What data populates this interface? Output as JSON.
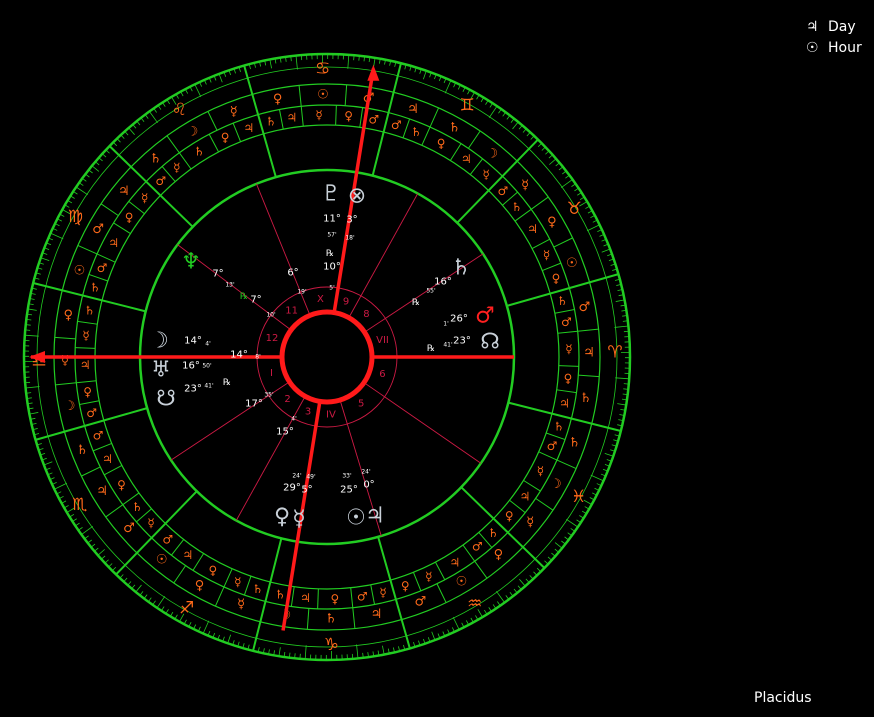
{
  "legend": {
    "day": {
      "symbol": "♃",
      "label": "Day"
    },
    "hour": {
      "symbol": "☉",
      "label": "Hour"
    }
  },
  "house_system": "Placidus",
  "colors": {
    "ring": "#22cc22",
    "axis": "#ff1a1a",
    "cusp_line": "#cc1a44",
    "planet_light": "#c8d0d8",
    "orange": "#ff6a1a",
    "text": "#ffffff"
  },
  "zodiac_signs": [
    {
      "symbol": "♈",
      "color": "#ff6a1a"
    },
    {
      "symbol": "♉",
      "color": "#ff6a1a"
    },
    {
      "symbol": "♊",
      "color": "#ff6a1a"
    },
    {
      "symbol": "♋",
      "color": "#ff6a1a"
    },
    {
      "symbol": "♌",
      "color": "#ff6a1a"
    },
    {
      "symbol": "♍",
      "color": "#ff6a1a"
    },
    {
      "symbol": "♎",
      "color": "#ff6a1a"
    },
    {
      "symbol": "♏",
      "color": "#ff6a1a"
    },
    {
      "symbol": "♐",
      "color": "#ff6a1a"
    },
    {
      "symbol": "♑",
      "color": "#ff6a1a"
    },
    {
      "symbol": "♒",
      "color": "#ff6a1a"
    },
    {
      "symbol": "♓",
      "color": "#ff6a1a"
    }
  ],
  "decan_rulers": [
    "♄",
    "♃",
    "♂",
    "☉",
    "♀",
    "☿",
    "☽",
    "♄",
    "♃",
    "♂",
    "☉",
    "♀",
    "☿",
    "☽",
    "♄",
    "♃",
    "♂",
    "☉",
    "♀",
    "☿",
    "☽",
    "♄",
    "♃",
    "♂",
    "☉",
    "♀",
    "☿",
    "☽",
    "♄",
    "♃",
    "♂",
    "☉",
    "♀",
    "☿",
    "☽",
    "♄"
  ],
  "term_rulers": [
    "♃",
    "♀",
    "☿",
    "♂",
    "♄",
    "♀",
    "☿",
    "♃",
    "♄",
    "♂",
    "☿",
    "♃",
    "♀",
    "♄",
    "♂",
    "♂",
    "♀",
    "☿",
    "♃",
    "♄",
    "♃",
    "♀",
    "♄",
    "☿",
    "♂",
    "☿",
    "♀",
    "♃",
    "♂",
    "♄",
    "♄",
    "☿",
    "♃",
    "♀",
    "♂",
    "♂",
    "♃",
    "♀",
    "♄",
    "☿",
    "♂",
    "♃",
    "♀",
    "☿",
    "♄",
    "♄",
    "♃",
    "♀",
    "♂",
    "☿",
    "♀",
    "☿",
    "♃",
    "♂",
    "♄",
    "♀",
    "♃",
    "☿",
    "♂",
    "♄"
  ],
  "houses": {
    "numbers": [
      "I",
      "2",
      "3",
      "IV",
      "5",
      "6",
      "VII",
      "8",
      "9",
      "X",
      "11",
      "12"
    ],
    "cusps": [
      {
        "deg": "14°",
        "min": "8'"
      },
      {
        "deg": "17°",
        "min": "35'"
      },
      {
        "deg": "15°",
        "min": "4'"
      },
      {
        "deg": "",
        "min": ""
      },
      {
        "deg": "",
        "min": ""
      },
      {
        "deg": "",
        "min": ""
      },
      {
        "deg": "",
        "min": ""
      },
      {
        "deg": "",
        "min": ""
      },
      {
        "deg": "",
        "min": ""
      },
      {
        "deg": "",
        "min": ""
      },
      {
        "deg": "6°",
        "min": "19'"
      },
      {
        "deg": "7°",
        "min": "10'"
      }
    ]
  },
  "planets": [
    {
      "name": "pluto",
      "symbol": "♇",
      "deg": "11°",
      "min": "57'",
      "retro": "℞",
      "color": "#c8d0d8"
    },
    {
      "name": "part-of-fortune",
      "symbol": "⊗",
      "deg": "3°",
      "min": "18'",
      "retro": "",
      "color": "#c8d0d8"
    },
    {
      "name": "mc",
      "symbol": "",
      "deg": "10°",
      "min": "5'",
      "retro": "",
      "color": "#ffffff"
    },
    {
      "name": "saturn",
      "symbol": "♄",
      "deg": "16°",
      "min": "55'",
      "retro": "℞",
      "color": "#c8d0d8"
    },
    {
      "name": "mars",
      "symbol": "♂",
      "deg": "26°",
      "min": "1'",
      "retro": "",
      "color": "#ff2020"
    },
    {
      "name": "north-node",
      "symbol": "☊",
      "deg": "23°",
      "min": "41'",
      "retro": "℞",
      "color": "#c8d0d8"
    },
    {
      "name": "neptune",
      "symbol": "♆",
      "deg": "7°",
      "min": "13'",
      "retro": "℞",
      "color": "#22cc22"
    },
    {
      "name": "moon",
      "symbol": "☽",
      "deg": "14°",
      "min": "4'",
      "retro": "",
      "color": "#c8d0d8"
    },
    {
      "name": "uranus",
      "symbol": "♅",
      "deg": "16°",
      "min": "50'",
      "retro": "",
      "color": "#c8d0d8"
    },
    {
      "name": "south-node",
      "symbol": "☋",
      "deg": "23°",
      "min": "41'",
      "retro": "℞",
      "color": "#c8d0d8"
    },
    {
      "name": "venus",
      "symbol": "♀",
      "deg": "29°",
      "min": "24'",
      "retro": "",
      "color": "#c8d0d8"
    },
    {
      "name": "mercury",
      "symbol": "☿",
      "deg": "5°",
      "min": "49'",
      "retro": "",
      "color": "#c8d0d8"
    },
    {
      "name": "sun",
      "symbol": "☉",
      "deg": "25°",
      "min": "33'",
      "retro": "",
      "color": "#c8d0d8"
    },
    {
      "name": "jupiter",
      "symbol": "♃",
      "deg": "0°",
      "min": "24'",
      "retro": "",
      "color": "#c8d0d8"
    }
  ]
}
